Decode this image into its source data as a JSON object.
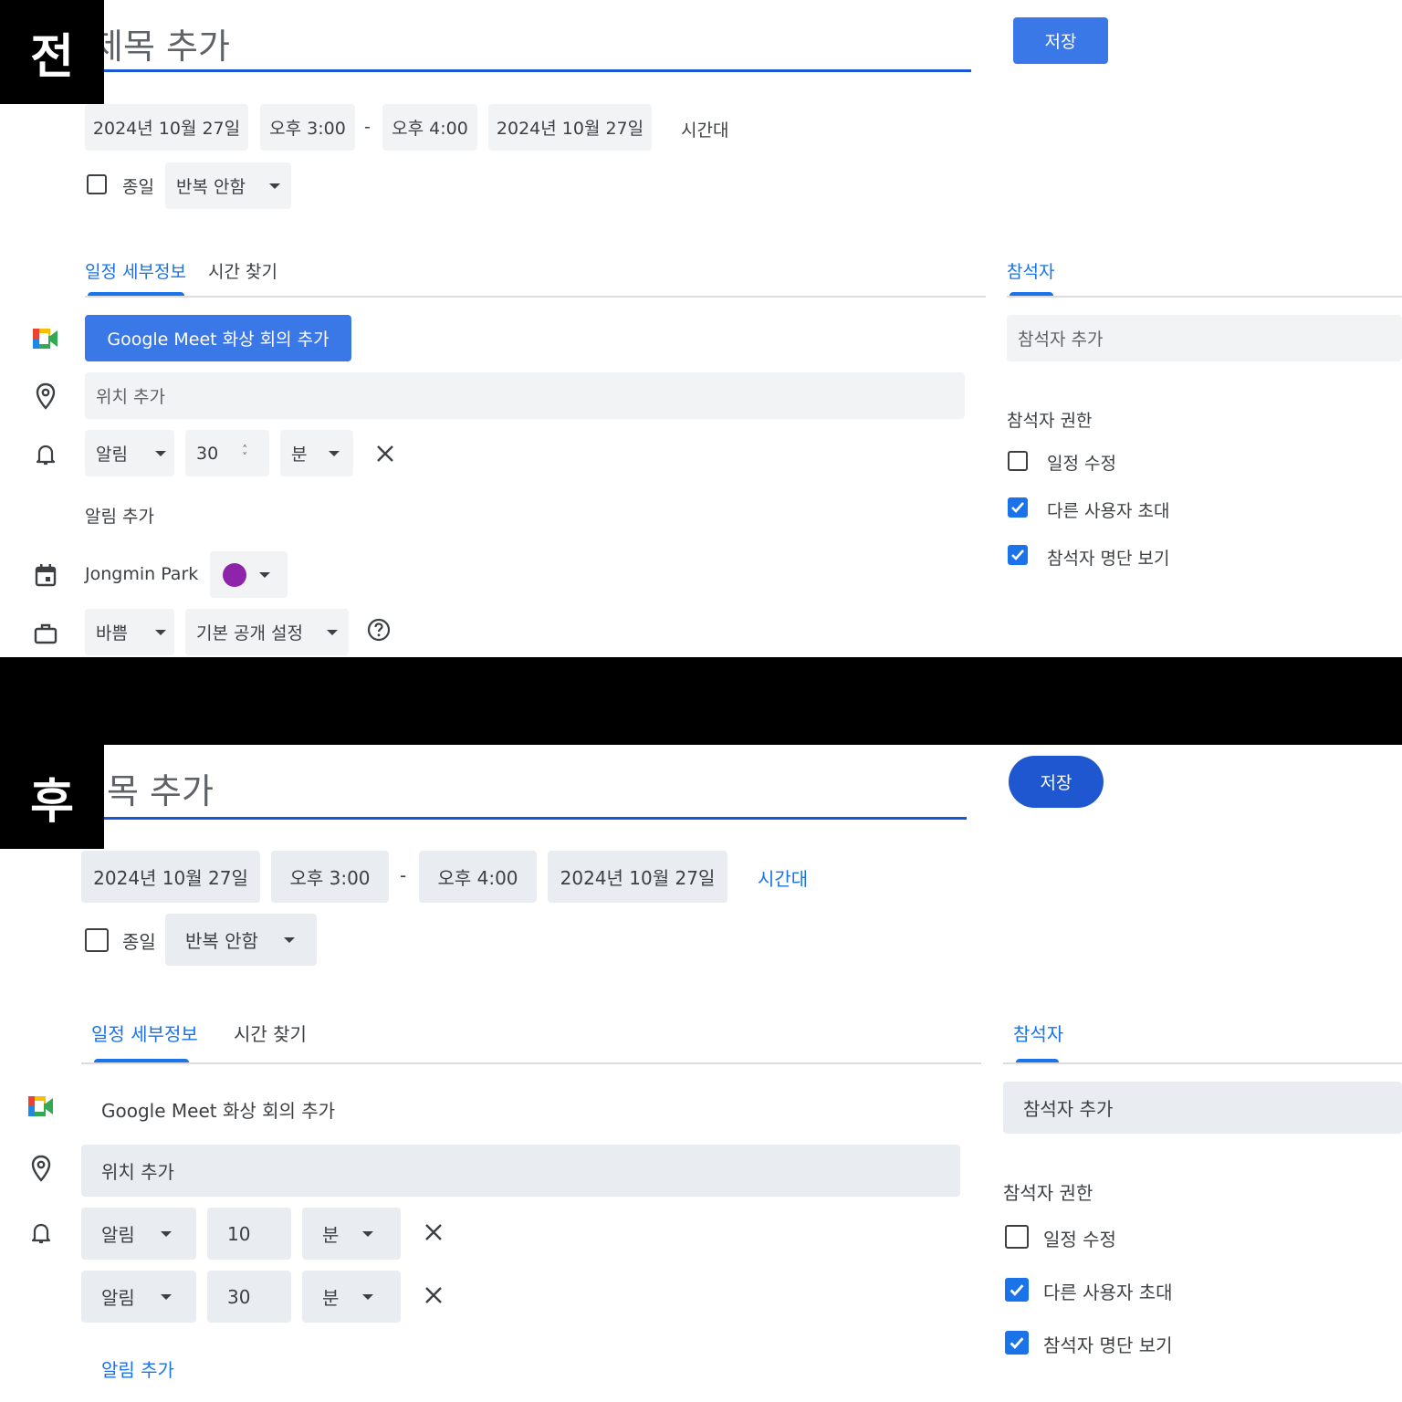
{
  "before": {
    "badge": "전",
    "title_placeholder": "제목 추가",
    "save_label": "저장",
    "start_date": "2024년 10월 27일",
    "start_time": "오후 3:00",
    "dash": "-",
    "end_time": "오후 4:00",
    "end_date": "2024년 10월 27일",
    "timezone_label": "시간대",
    "all_day_label": "종일",
    "repeat_label": "반복 안함",
    "tabs": {
      "details": "일정 세부정보",
      "find_time": "시간 찾기",
      "guests": "참석자"
    },
    "meet_button": "Google Meet 화상 회의 추가",
    "location_placeholder": "위치 추가",
    "notification": {
      "type": "알림",
      "value": "30",
      "unit": "분"
    },
    "add_notification": "알림 추가",
    "calendar_owner": "Jongmin Park",
    "calendar_color": "#8e24aa",
    "availability": "바쁨",
    "visibility": "기본 공개 설정",
    "guests_placeholder": "참석자 추가",
    "permissions_title": "참석자 권한",
    "permissions": [
      {
        "label": "일정 수정",
        "checked": false
      },
      {
        "label": "다른 사용자 초대",
        "checked": true
      },
      {
        "label": "참석자 명단 보기",
        "checked": true
      }
    ]
  },
  "after": {
    "badge": "후",
    "title_placeholder": "제목 추가",
    "save_label": "저장",
    "start_date": "2024년 10월 27일",
    "start_time": "오후 3:00",
    "dash": "-",
    "end_time": "오후 4:00",
    "end_date": "2024년 10월 27일",
    "timezone_label": "시간대",
    "all_day_label": "종일",
    "repeat_label": "반복 안함",
    "tabs": {
      "details": "일정 세부정보",
      "find_time": "시간 찾기",
      "guests": "참석자"
    },
    "meet_button": "Google Meet 화상 회의 추가",
    "location_placeholder": "위치 추가",
    "notifications": [
      {
        "type": "알림",
        "value": "10",
        "unit": "분"
      },
      {
        "type": "알림",
        "value": "30",
        "unit": "분"
      }
    ],
    "add_notification": "알림 추가",
    "guests_placeholder": "참석자 추가",
    "permissions_title": "참석자 권한",
    "permissions": [
      {
        "label": "일정 수정",
        "checked": false
      },
      {
        "label": "다른 사용자 초대",
        "checked": true
      },
      {
        "label": "참석자 명단 보기",
        "checked": true
      }
    ]
  },
  "colors": {
    "primary_blue": "#1a73e8",
    "save_before": "#3b78e7",
    "save_after": "#1f57d1"
  }
}
